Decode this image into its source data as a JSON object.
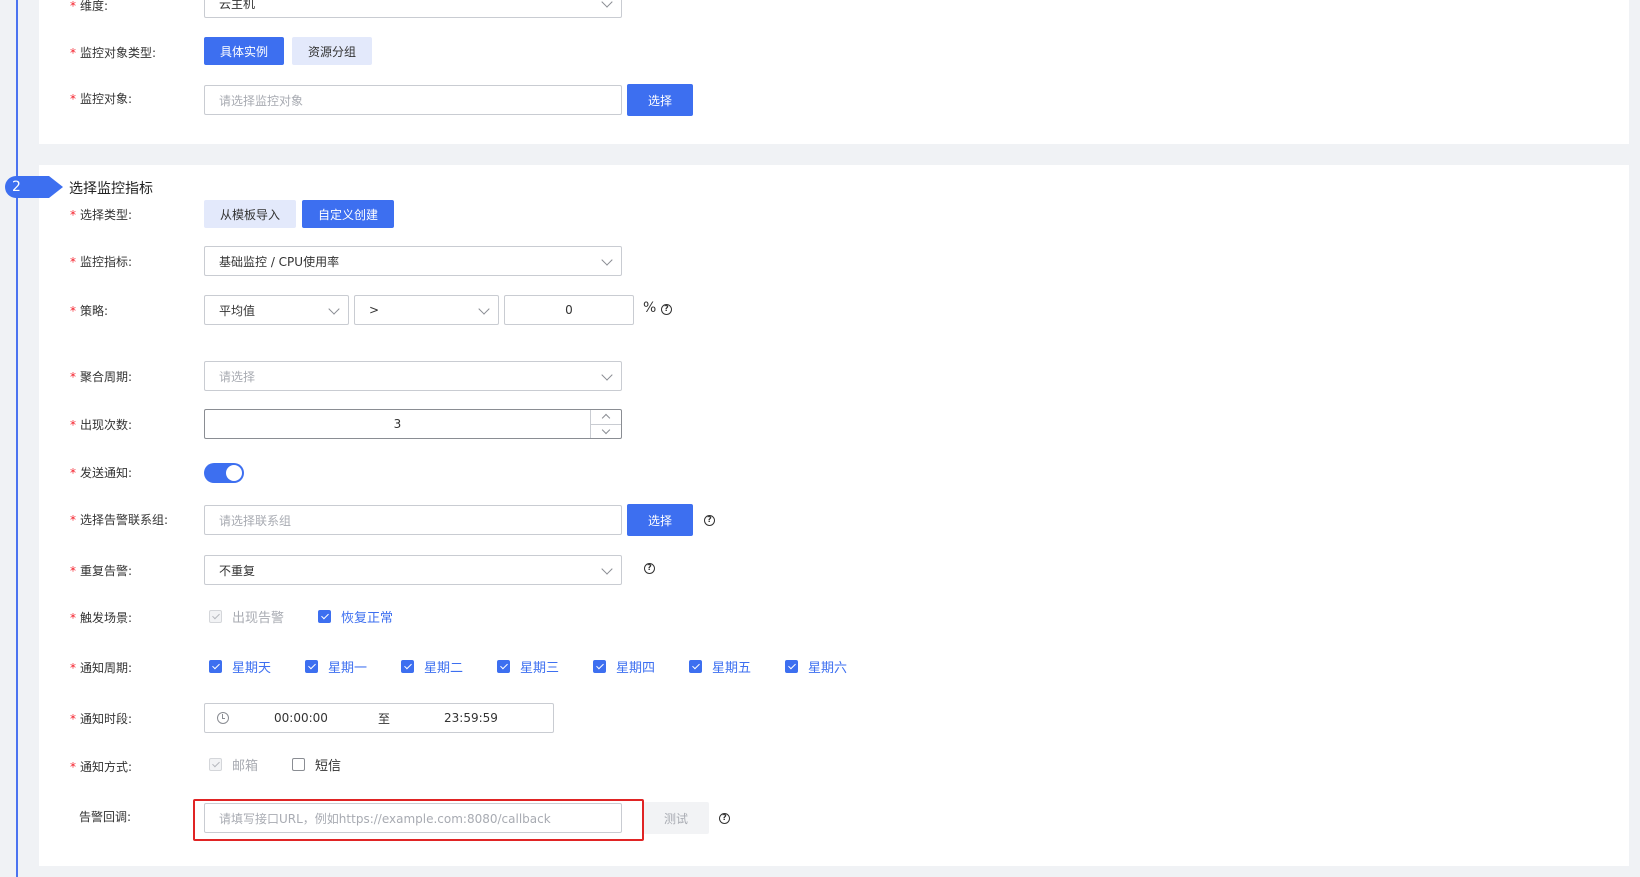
{
  "card1": {
    "dimension_label": "维度:",
    "dimension_value": "云主机",
    "target_type_label": "监控对象类型:",
    "target_type_options": [
      "具体实例",
      "资源分组"
    ],
    "target_label": "监控对象:",
    "target_placeholder": "请选择监控对象",
    "target_select_btn": "选择"
  },
  "step": {
    "number": "2",
    "title": "选择监控指标"
  },
  "form": {
    "select_type_label": "选择类型:",
    "select_type_options": [
      "从模板导入",
      "自定义创建"
    ],
    "metric_label": "监控指标:",
    "metric_value": "基础监控 / CPU使用率",
    "strategy_label": "策略:",
    "strategy_agg": "平均值",
    "strategy_op": ">",
    "strategy_threshold": "0",
    "strategy_unit": "%",
    "period_label": "聚合周期:",
    "period_placeholder": "请选择",
    "count_label": "出现次数:",
    "count_value": "3",
    "notify_label": "发送通知:",
    "notify_on": true,
    "contact_label": "选择告警联系组:",
    "contact_placeholder": "请选择联系组",
    "contact_btn": "选择",
    "repeat_label": "重复告警:",
    "repeat_value": "不重复",
    "trigger_label": "触发场景:",
    "trigger_options": [
      {
        "label": "出现告警",
        "checked": true,
        "disabled": true
      },
      {
        "label": "恢复正常",
        "checked": true,
        "disabled": false
      }
    ],
    "cycle_label": "通知周期:",
    "cycle_days": [
      "星期天",
      "星期一",
      "星期二",
      "星期三",
      "星期四",
      "星期五",
      "星期六"
    ],
    "timerange_label": "通知时段:",
    "time_start": "00:00:00",
    "time_sep": "至",
    "time_end": "23:59:59",
    "method_label": "通知方式:",
    "method_options": [
      {
        "label": "邮箱",
        "checked": true,
        "disabled": true
      },
      {
        "label": "短信",
        "checked": false,
        "disabled": false
      }
    ],
    "callback_label": "告警回调:",
    "callback_placeholder": "请填写接口URL，例如https://example.com:8080/callback",
    "callback_test_btn": "测试"
  },
  "colors": {
    "primary": "#3d6ff0",
    "required": "#f5222d",
    "highlight": "#e02424"
  }
}
